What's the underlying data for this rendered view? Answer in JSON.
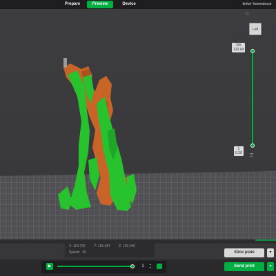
{
  "nav": {
    "tabs": [
      {
        "label": "Prepare"
      },
      {
        "label": "Preview"
      },
      {
        "label": "Device"
      }
    ],
    "project_name": "tinker homedecor"
  },
  "view": {
    "cube_face_label": "Left",
    "home_icon": "home-icon"
  },
  "layer_slider": {
    "top_layer": "765",
    "top_height": "120.04",
    "bottom_layer": "1",
    "bottom_height": "0.20",
    "menu_icon": "menu-icon"
  },
  "coordinates": {
    "x_label": "X:",
    "x_value": "119.755",
    "y_label": "Y:",
    "y_value": "181.487",
    "z_label": "Z:",
    "z_value": "120.040",
    "speed_label": "Speed:",
    "speed_value": "25"
  },
  "playback": {
    "step_value": "1",
    "progress": 1.0,
    "play_icon": "play-icon"
  },
  "actions": {
    "slice_label": "Slice plate",
    "send_label": "Send print",
    "more_icon": "more-icon"
  },
  "colors": {
    "accent": "#00ae42",
    "model_orange": "#c86428",
    "support_green": "#27c22e"
  }
}
